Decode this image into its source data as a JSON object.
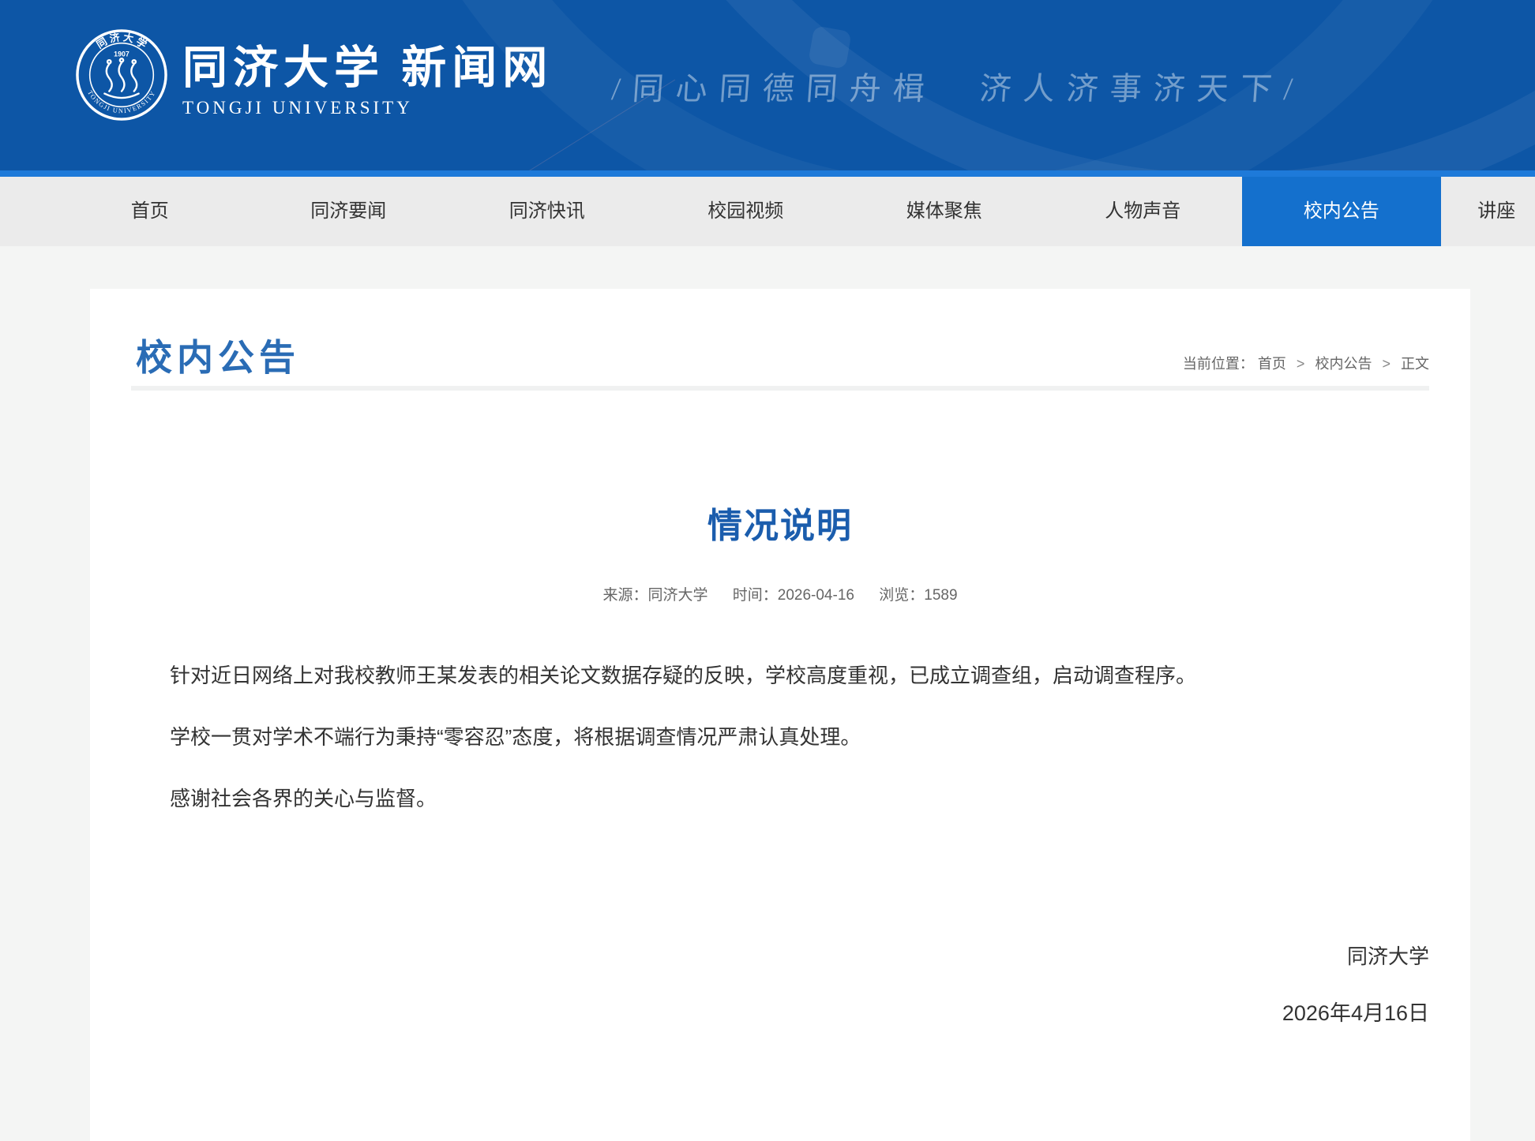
{
  "header": {
    "site_name_cn": "同济大学 新闻网",
    "site_name_en": "TONGJI UNIVERSITY",
    "slogan": "/同心同德同舟楫　济人济事济天下/",
    "seal": {
      "year": "1907",
      "ring_text_cn": "同 济 大 学",
      "ring_text_en": "TONGJI UNIVERSITY"
    }
  },
  "nav": {
    "items": [
      {
        "label": "首页",
        "active": false
      },
      {
        "label": "同济要闻",
        "active": false
      },
      {
        "label": "同济快讯",
        "active": false
      },
      {
        "label": "校园视频",
        "active": false
      },
      {
        "label": "媒体聚焦",
        "active": false
      },
      {
        "label": "人物声音",
        "active": false
      },
      {
        "label": "校内公告",
        "active": true
      },
      {
        "label": "讲座",
        "active": false
      }
    ]
  },
  "page": {
    "section_title": "校内公告",
    "breadcrumb": {
      "prefix": "当前位置：",
      "separator": ">",
      "items": [
        "首页",
        "校内公告",
        "正文"
      ]
    }
  },
  "article": {
    "title": "情况说明",
    "meta": {
      "source_label": "来源：",
      "source": "同济大学",
      "time_label": "时间：",
      "time": "2026-04-16",
      "views_label": "浏览：",
      "views": "1589"
    },
    "paragraphs": [
      "针对近日网络上对我校教师王某发表的相关论文数据存疑的反映，学校高度重视，已成立调查组，启动调查程序。",
      "学校一贯对学术不端行为秉持“零容忍”态度，将根据调查情况严肃认真处理。",
      "感谢社会各界的关心与监督。"
    ],
    "signature": "同济大学",
    "date": "2026年4月16日"
  },
  "colors": {
    "brand_blue": "#0d56a6",
    "strip_blue": "#1e7ad9",
    "active_tab_blue": "#1470cd",
    "nav_bg": "#ebebeb",
    "page_bg": "#f4f5f4",
    "heading_blue": "#2a6cb5",
    "title_blue": "#1b5dad",
    "text_dark": "#333333",
    "text_muted": "#666666",
    "divider": "#f0f1f1"
  }
}
